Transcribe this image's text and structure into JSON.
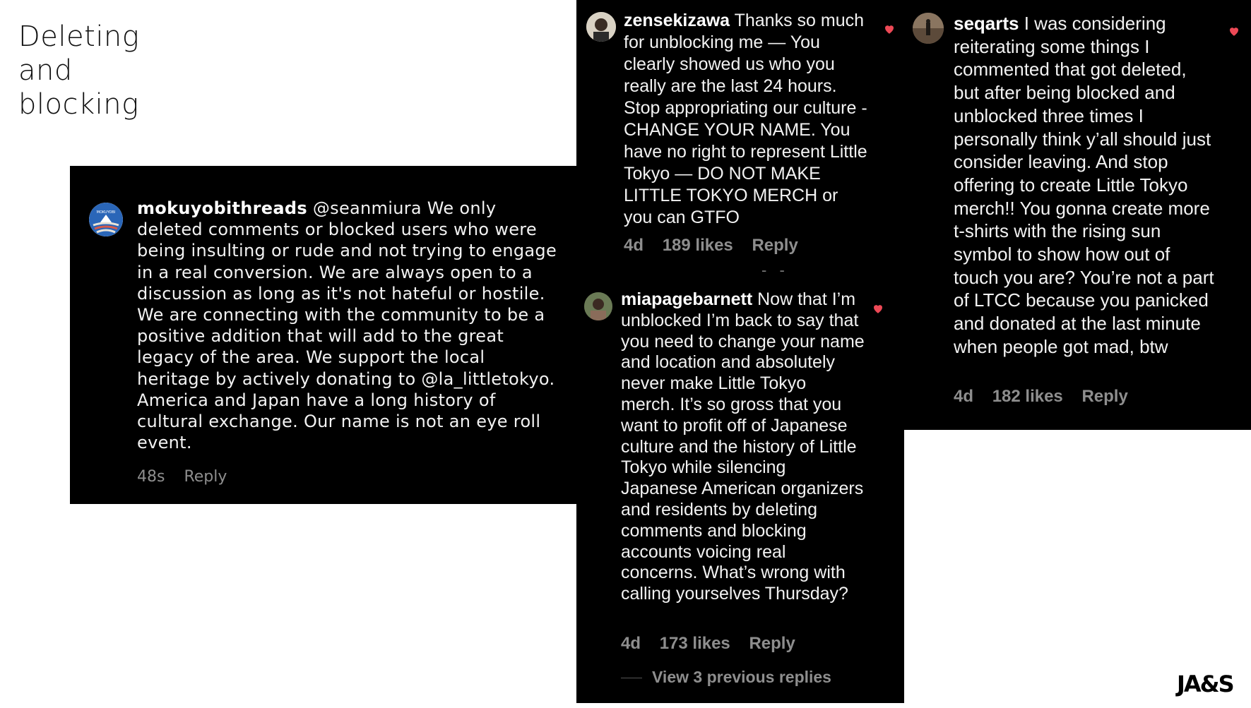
{
  "slide": {
    "title_lines": [
      "Deleting",
      "and",
      "blocking"
    ]
  },
  "comments": {
    "mokuyobi": {
      "username": "mokuyobithreads",
      "text": "@seanmiura We only deleted comments or blocked users who were being insulting or rude and not trying to engage in a real conversion. We are always open to a discussion as long as it's not hateful or hostile. We are connecting with the community to be a positive addition that will add to the great legacy of the area. We support the local heritage by actively donating to @la_littletokyo. America and Japan have a long history of cultural exchange. Our name is not an eye roll event.",
      "time": "48s",
      "reply": "Reply",
      "avatar_text": "MOKUYOBI"
    },
    "zensekizawa": {
      "username": "zensekizawa",
      "text": "Thanks so much for unblocking me — You clearly showed us who you really are the last 24 hours. Stop appropriating our culture - CHANGE YOUR NAME. You have no right to represent Little Tokyo — DO NOT MAKE LITTLE TOKYO MERCH or you can GTFO",
      "time": "4d",
      "likes": "189 likes",
      "reply": "Reply"
    },
    "miapagebarnett": {
      "username": "miapagebarnett",
      "text": "Now that I’m unblocked I’m back to say that you need to change your name and location and absolutely never make Little Tokyo merch. It’s so gross that you want to profit off of Japanese culture and the history of Little Tokyo while silencing Japanese American organizers and residents by deleting comments and blocking accounts voicing real concerns. What’s wrong with calling yourselves Thursday?",
      "time": "4d",
      "likes": "173 likes",
      "reply": "Reply",
      "view_previous": "View 3 previous replies"
    },
    "seqarts": {
      "username": "seqarts",
      "text": "I was considering reiterating some things I commented that got deleted, but after being blocked and unblocked three times I personally think y’all should just consider leaving. And stop offering to create Little Tokyo merch!! You gonna create more t-shirts with the rising sun symbol to show how out of touch you are? You’re not a part of LTCC because you panicked and donated at the last minute when people got mad, btw",
      "time": "4d",
      "likes": "182 likes",
      "reply": "Reply"
    }
  },
  "logo": {
    "text": "JA&S"
  },
  "colors": {
    "panel_bg": "#000000",
    "heart": "#ed4956",
    "meta_gray": "#8e8e8e"
  }
}
